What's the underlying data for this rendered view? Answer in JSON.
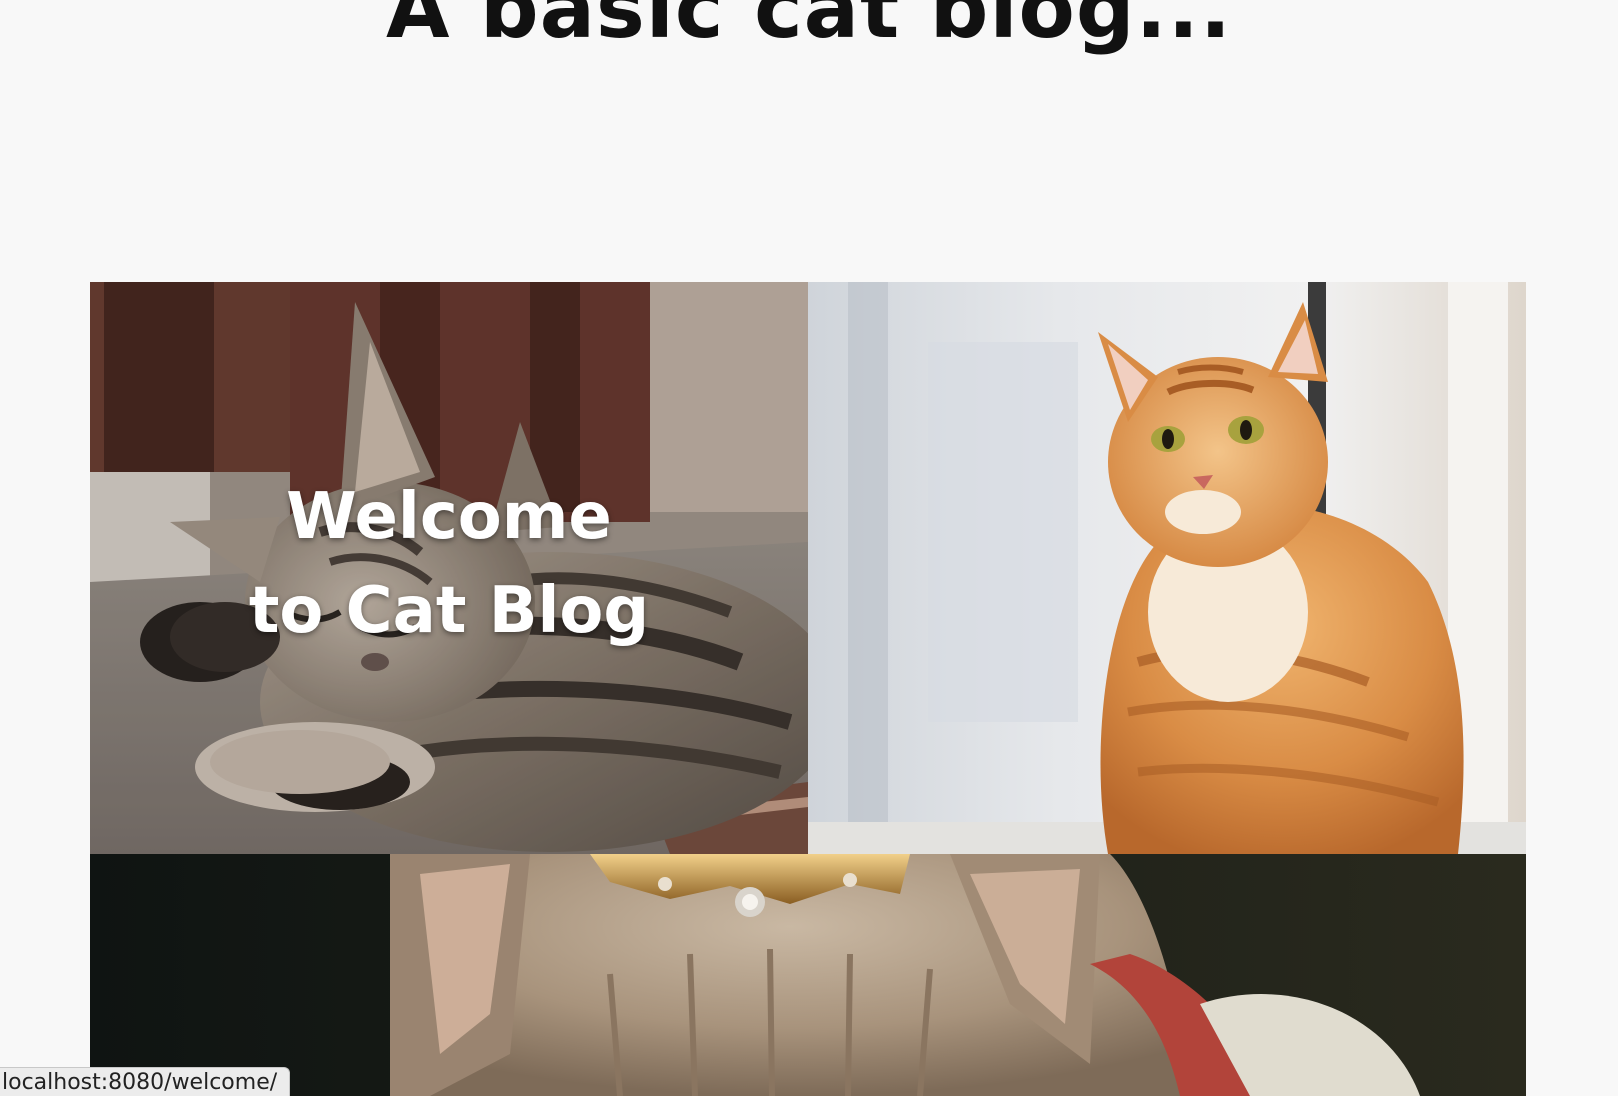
{
  "page": {
    "title": "A basic cat blog..."
  },
  "hero": {
    "welcome_text": "Welcome to Cat Blog"
  },
  "status_bar": {
    "url": "localhost:8080/welcome/"
  },
  "colors": {
    "background": "#f8f8f8",
    "title": "#111111",
    "welcome_text": "#ffffff"
  }
}
